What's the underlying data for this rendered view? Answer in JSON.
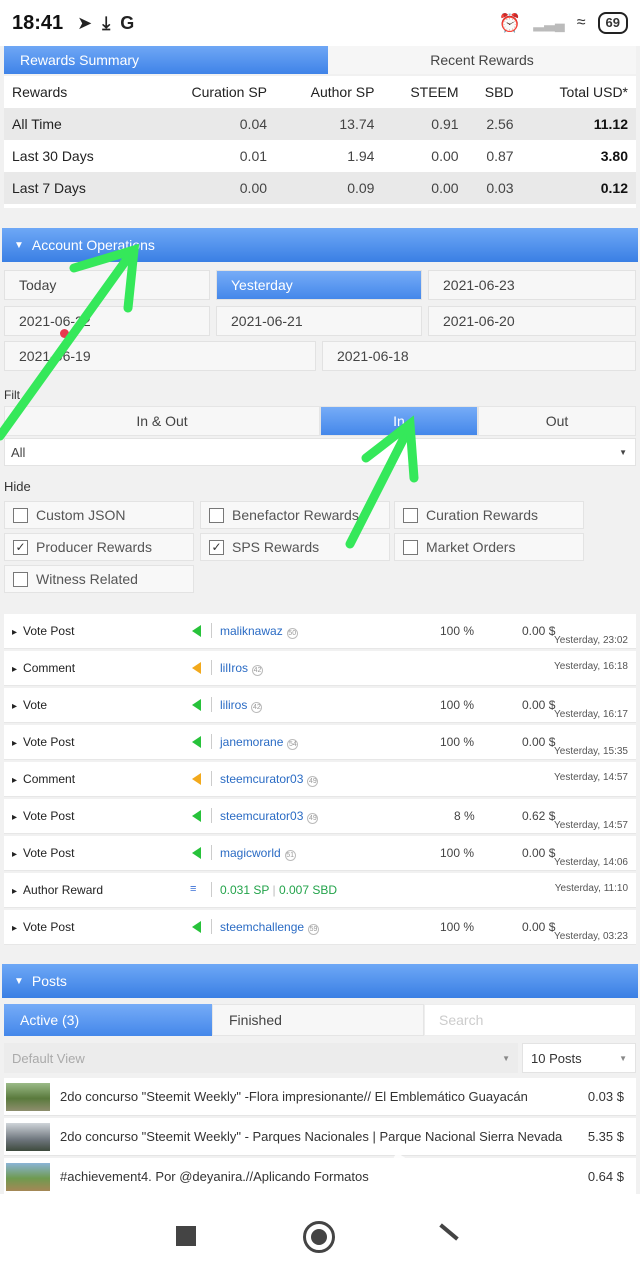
{
  "status_bar": {
    "time": "18:41",
    "left_icons": [
      "telegram-icon",
      "download-icon",
      "google-icon"
    ],
    "battery": "69"
  },
  "rewards_tabs": {
    "summary": "Rewards Summary",
    "recent": "Recent Rewards"
  },
  "rewards_table": {
    "headers": [
      "Rewards",
      "Curation SP",
      "Author SP",
      "STEEM",
      "SBD",
      "Total USD*"
    ],
    "rows": [
      [
        "All Time",
        "0.04",
        "13.74",
        "0.91",
        "2.56",
        "11.12"
      ],
      [
        "Last 30 Days",
        "0.01",
        "1.94",
        "0.00",
        "0.87",
        "3.80"
      ],
      [
        "Last 7 Days",
        "0.00",
        "0.09",
        "0.00",
        "0.03",
        "0.12"
      ]
    ]
  },
  "account_operations": {
    "title": "Account Operations",
    "dates": [
      "Today",
      "Yesterday",
      "2021-06-23",
      "2021-06-22",
      "2021-06-21",
      "2021-06-20",
      "2021-06-19",
      "2021-06-18"
    ],
    "filter_label": "Filt",
    "direction": [
      "In & Out",
      "In",
      "Out"
    ],
    "type_select": "All",
    "hide_label": "Hide",
    "hide_options": [
      {
        "label": "Custom JSON",
        "checked": false
      },
      {
        "label": "Benefactor Rewards",
        "checked": false
      },
      {
        "label": "Curation Rewards",
        "checked": false
      },
      {
        "label": "Producer Rewards",
        "checked": true
      },
      {
        "label": "SPS Rewards",
        "checked": true
      },
      {
        "label": "Market Orders",
        "checked": false
      },
      {
        "label": "Witness Related",
        "checked": false
      }
    ],
    "ops": [
      {
        "type": "Vote Post",
        "user": "maliknawaz",
        "rep": "50",
        "pct": "100 %",
        "amount": "0.00 $",
        "time": "Yesterday, 23:02"
      },
      {
        "type": "Comment",
        "user": "lilIros",
        "rep": "42",
        "time": "Yesterday, 16:18"
      },
      {
        "type": "Vote",
        "user": "liliros",
        "rep": "42",
        "pct": "100 %",
        "amount": "0.00 $",
        "time": "Yesterday, 16:17"
      },
      {
        "type": "Vote Post",
        "user": "janemorane",
        "rep": "54",
        "pct": "100 %",
        "amount": "0.00 $",
        "time": "Yesterday, 15:35"
      },
      {
        "type": "Comment",
        "user": "steemcurator03",
        "rep": "49",
        "time": "Yesterday, 14:57"
      },
      {
        "type": "Vote Post",
        "user": "steemcurator03",
        "rep": "49",
        "pct": "8 %",
        "amount": "0.62 $",
        "time": "Yesterday, 14:57"
      },
      {
        "type": "Vote Post",
        "user": "magicworld",
        "rep": "51",
        "pct": "100 %",
        "amount": "0.00 $",
        "time": "Yesterday, 14:06"
      },
      {
        "type": "Author Reward",
        "sp": "0.031 SP",
        "sbd": "0.007 SBD",
        "time": "Yesterday, 11:10"
      },
      {
        "type": "Vote Post",
        "user": "steemchallenge",
        "rep": "59",
        "pct": "100 %",
        "amount": "0.00 $",
        "time": "Yesterday, 03:23"
      }
    ]
  },
  "posts": {
    "title": "Posts",
    "tabs": {
      "active": "Active (3)",
      "finished": "Finished"
    },
    "search_placeholder": "Search",
    "view": "Default View",
    "count": "10 Posts",
    "items": [
      {
        "title": "2do concurso \"Steemit Weekly\" -Flora impresionante// El Emblemático Guayacán",
        "value": "0.03 $"
      },
      {
        "title": "2do concurso \"Steemit Weekly\" - Parques Nacionales | Parque Nacional Sierra Nevada",
        "value": "5.35 $"
      },
      {
        "title": "#achievement4. Por @deyanira.//Aplicando Formatos",
        "value": "0.64 $"
      }
    ]
  },
  "colors": {
    "accent": "#3f83e8",
    "green_flag": "#27c23a",
    "orange_flag": "#f2a91c",
    "arrow": "#35e85a"
  }
}
